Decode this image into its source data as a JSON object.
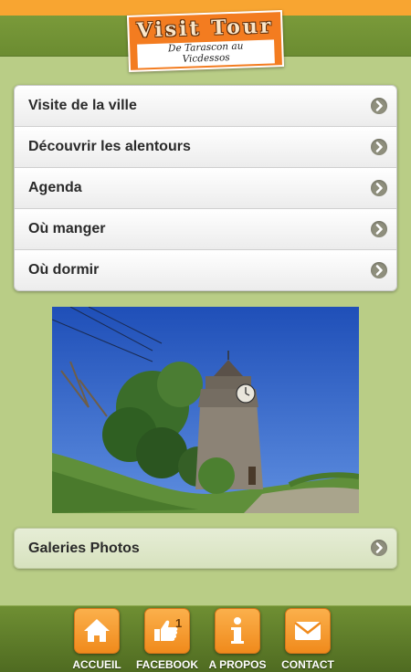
{
  "header": {
    "logo_title": "Visit Tour",
    "logo_subtitle_line1": "De Tarascon au",
    "logo_subtitle_line2": "Vicdessos"
  },
  "menu": {
    "items": [
      {
        "label": "Visite de la ville",
        "icon": "chevron-right-icon"
      },
      {
        "label": "Découvrir les alentours",
        "icon": "chevron-right-icon"
      },
      {
        "label": "Agenda",
        "icon": "chevron-right-icon"
      },
      {
        "label": "Où manger",
        "icon": "chevron-right-icon"
      },
      {
        "label": "Où dormir",
        "icon": "chevron-right-icon"
      }
    ]
  },
  "photo": {
    "subject": "clock-tower-photo"
  },
  "gallery": {
    "label": "Galeries Photos",
    "icon": "chevron-right-icon"
  },
  "tabbar": {
    "tabs": [
      {
        "label": "ACCUEIL",
        "icon": "home-icon"
      },
      {
        "label": "FACEBOOK",
        "icon": "thumbs-up-icon",
        "count": "1"
      },
      {
        "label": "A PROPOS",
        "icon": "info-icon"
      },
      {
        "label": "CONTACT",
        "icon": "envelope-icon"
      }
    ]
  },
  "colors": {
    "background": "#b9cd86",
    "top_orange": "#f8a531",
    "top_green": "#6b8c31",
    "tab_button": "#f39a2a",
    "chevron": "#8f8f7d"
  }
}
